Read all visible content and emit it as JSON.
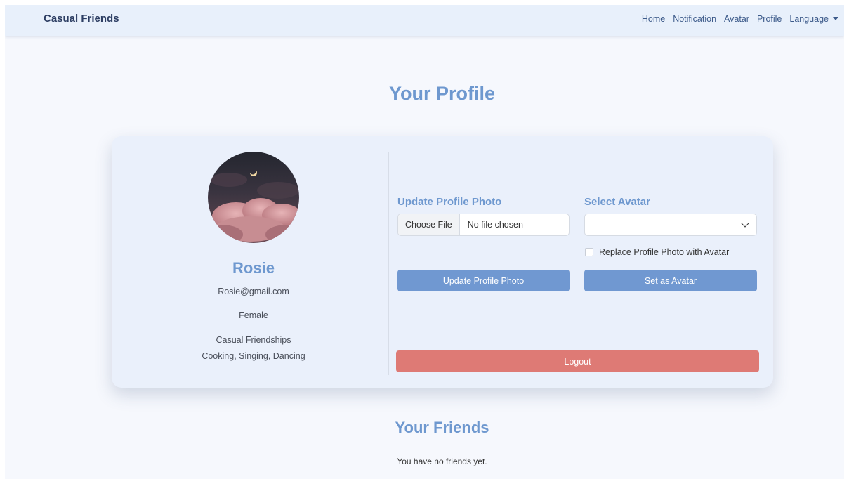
{
  "navbar": {
    "brand": "Casual Friends",
    "links": [
      "Home",
      "Notification",
      "Avatar",
      "Profile",
      "Language"
    ]
  },
  "page_title": "Your Profile",
  "profile": {
    "name": "Rosie",
    "email": "Rosie@gmail.com",
    "gender": "Female",
    "looking_for": "Casual Friendships",
    "interests": "Cooking, Singing, Dancing"
  },
  "update_photo": {
    "label": "Update Profile Photo",
    "choose_file_label": "Choose File",
    "file_status": "No file chosen",
    "button_label": "Update Profile Photo"
  },
  "select_avatar": {
    "label": "Select Avatar",
    "selected_value": "",
    "checkbox_label": "Replace Profile Photo with Avatar",
    "button_label": "Set as Avatar"
  },
  "logout_label": "Logout",
  "friends": {
    "title": "Your Friends",
    "empty_message": "You have no friends yet."
  },
  "colors": {
    "accent": "#6e98cf",
    "button_primary": "#7098d1",
    "button_danger": "#de7a75",
    "navbar_bg": "#e8f0fb",
    "card_bg": "#eaf0fb"
  }
}
